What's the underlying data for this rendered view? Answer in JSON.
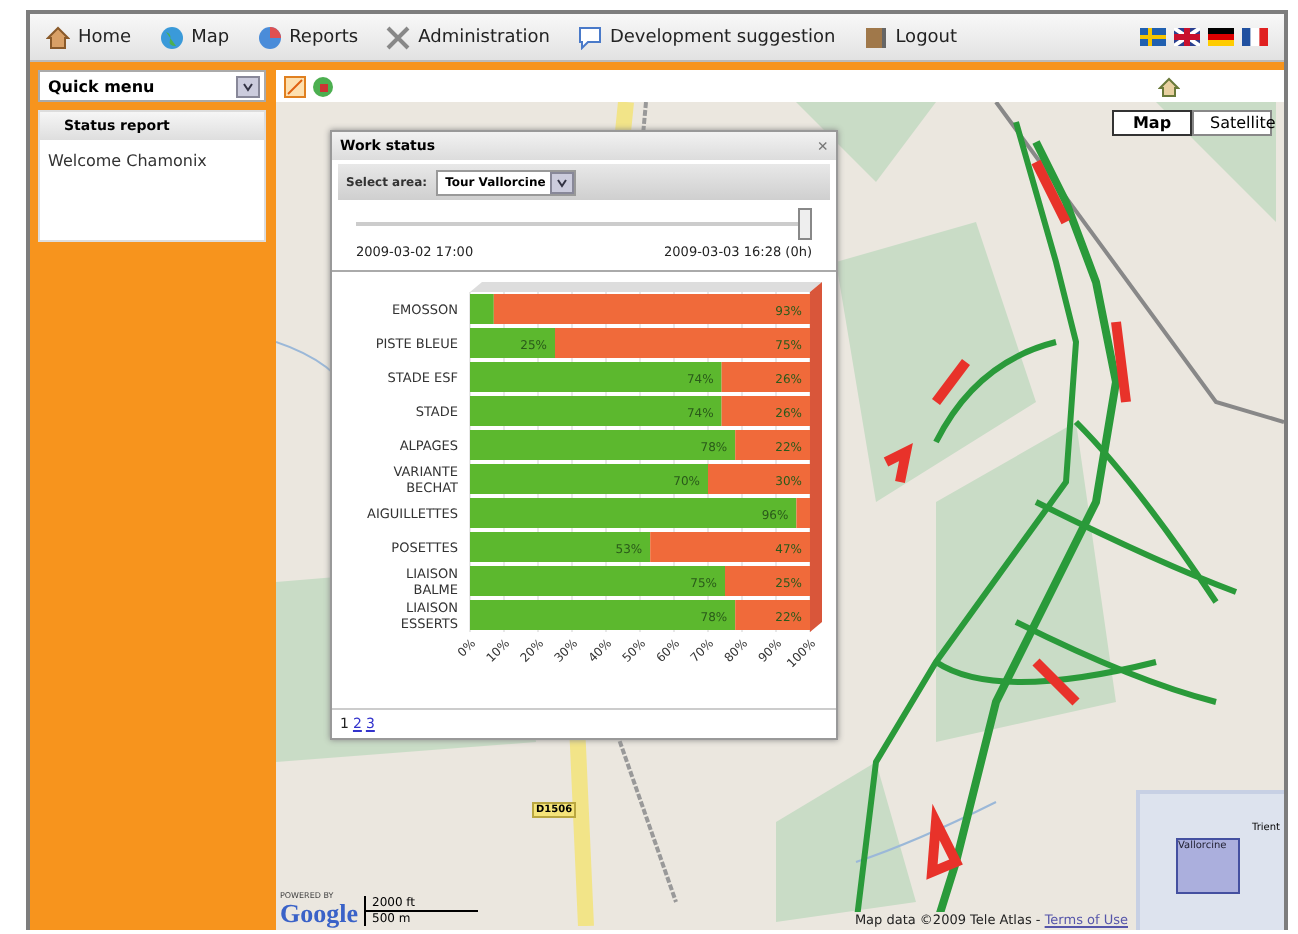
{
  "nav": {
    "items": [
      {
        "label": "Home",
        "kind": "home"
      },
      {
        "label": "Map",
        "kind": "globe"
      },
      {
        "label": "Reports",
        "kind": "reports"
      },
      {
        "label": "Administration",
        "kind": "tools"
      },
      {
        "label": "Development suggestion",
        "kind": "speech"
      },
      {
        "label": "Logout",
        "kind": "door"
      }
    ],
    "flags": [
      {
        "kind": "se"
      },
      {
        "kind": "gb"
      },
      {
        "kind": "de"
      },
      {
        "kind": "fr"
      }
    ]
  },
  "sidebar": {
    "quick_menu": "Quick menu",
    "panel_title": "Status report",
    "welcome": "Welcome Chamonix"
  },
  "map": {
    "type_buttons": [
      {
        "label": "Map",
        "selected": true
      },
      {
        "label": "Satellite",
        "selected": false
      }
    ],
    "road_label": "D1506",
    "overview_labels": [
      "Trient",
      "Vallorcine"
    ],
    "scale": [
      "2000 ft",
      "500 m"
    ],
    "logo_caption": "POWERED BY",
    "logo": "Google",
    "attribution": "Map data ©2009 Tele Atlas - ",
    "terms_link": "Terms of Use"
  },
  "work_status": {
    "title": "Work status",
    "close": "×",
    "select_label": "Select area:",
    "select_value": "Tour Vallorcine",
    "slider": {
      "level": 1.0
    },
    "start_date": "2009-03-02 17:00",
    "end_date": "2009-03-03 16:28 (0h)",
    "chart_data": {
      "type": "bar",
      "orientation": "horizontal",
      "stacked": true,
      "categories": [
        "EMOSSON",
        "PISTE BLEUE",
        "STADE ESF",
        "STADE",
        "ALPAGES",
        "VARIANTE\nBECHAT",
        "AIGUILLETTES",
        "POSETTES",
        "LIAISON\nBALME",
        "LIAISON\nESSERTS"
      ],
      "grid": true,
      "series": [
        {
          "color": "#5cb82e",
          "values": [
            7,
            25,
            74,
            74,
            78,
            70,
            96,
            53,
            75,
            78
          ],
          "value_labels": [
            null,
            "25%",
            "74%",
            "74%",
            "78%",
            "70%",
            "96%",
            "53%",
            "75%",
            "78%"
          ]
        },
        {
          "color": "#f06a3a",
          "values": [
            93,
            75,
            26,
            26,
            22,
            30,
            4,
            47,
            25,
            22
          ],
          "value_labels": [
            "93%",
            "75%",
            "26%",
            "26%",
            "22%",
            "30%",
            null,
            "47%",
            "25%",
            "22%"
          ]
        }
      ],
      "xlim": [
        0,
        100
      ],
      "xticks": [
        {
          "value": 0,
          "label": "0%"
        },
        {
          "value": 10,
          "label": "10%"
        },
        {
          "value": 20,
          "label": "20%"
        },
        {
          "value": 30,
          "label": "30%"
        },
        {
          "value": 40,
          "label": "40%"
        },
        {
          "value": 50,
          "label": "50%"
        },
        {
          "value": 60,
          "label": "60%"
        },
        {
          "value": 70,
          "label": "70%"
        },
        {
          "value": 80,
          "label": "80%"
        },
        {
          "value": 90,
          "label": "90%"
        },
        {
          "value": 100,
          "label": "100%"
        }
      ]
    },
    "pages": [
      {
        "label": "1",
        "selected": true
      },
      {
        "label": "2",
        "selected": false
      },
      {
        "label": "3",
        "selected": false
      }
    ]
  }
}
